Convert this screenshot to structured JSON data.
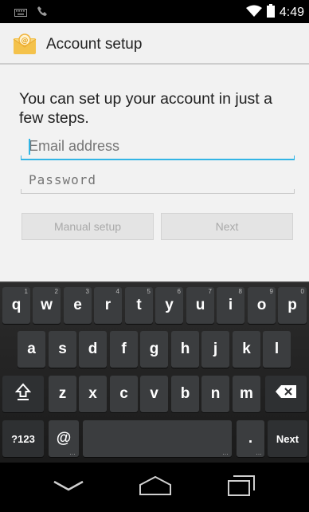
{
  "status_bar": {
    "time": "4:49",
    "icons": [
      "keyboard-icon",
      "phone-missed-icon",
      "wifi-icon",
      "battery-icon"
    ]
  },
  "action_bar": {
    "title": "Account setup",
    "icon": "email-app-icon"
  },
  "form": {
    "intro": "You can set up your account in just a few steps.",
    "email_placeholder": "Email address",
    "password_placeholder": "Password",
    "manual_setup_label": "Manual setup",
    "next_label": "Next"
  },
  "keyboard": {
    "row1": [
      {
        "key": "q",
        "hint": "1"
      },
      {
        "key": "w",
        "hint": "2"
      },
      {
        "key": "e",
        "hint": "3"
      },
      {
        "key": "r",
        "hint": "4"
      },
      {
        "key": "t",
        "hint": "5"
      },
      {
        "key": "y",
        "hint": "6"
      },
      {
        "key": "u",
        "hint": "7"
      },
      {
        "key": "i",
        "hint": "8"
      },
      {
        "key": "o",
        "hint": "9"
      },
      {
        "key": "p",
        "hint": "0"
      }
    ],
    "row2": [
      "a",
      "s",
      "d",
      "f",
      "g",
      "h",
      "j",
      "k",
      "l"
    ],
    "row3": [
      "z",
      "x",
      "c",
      "v",
      "b",
      "n",
      "m"
    ],
    "symbols_label": "?123",
    "at_label": "@",
    "period_label": ".",
    "action_label": "Next",
    "ellipsis": "…"
  },
  "nav_bar": {
    "icons": [
      "back-icon",
      "home-icon",
      "recents-icon"
    ]
  },
  "colors": {
    "accent": "#33b5e5",
    "background": "#f2f2f2",
    "key": "#3b3d3f"
  }
}
